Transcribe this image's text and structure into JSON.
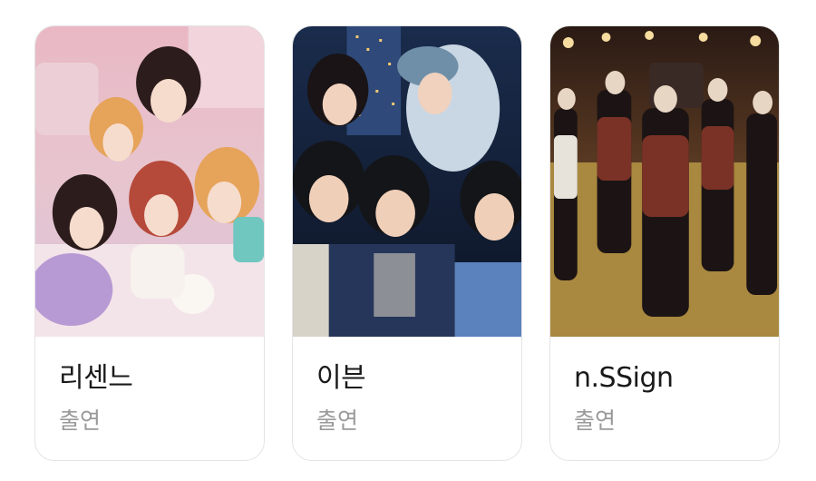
{
  "cards": [
    {
      "title": "리센느",
      "role": "출연",
      "image_icon": "group-photo-pink-room"
    },
    {
      "title": "이븐",
      "role": "출연",
      "image_icon": "group-photo-night-city"
    },
    {
      "title": "n.SSign",
      "role": "출연",
      "image_icon": "group-photo-stage"
    }
  ]
}
